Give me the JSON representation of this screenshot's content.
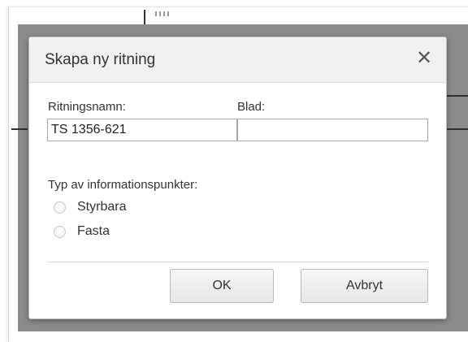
{
  "dialog": {
    "title": "Skapa ny ritning",
    "close_icon": "close-icon",
    "close_glyph": "✕"
  },
  "form": {
    "drawing_name_label": "Ritningsnamn:",
    "drawing_name_value": "TS 1356-621",
    "sheet_label": "Blad:",
    "sheet_value": "",
    "info_points_label": "Typ av informationspunkter:",
    "radio_options": [
      {
        "label": "Styrbara",
        "selected": false
      },
      {
        "label": "Fasta",
        "selected": false
      }
    ]
  },
  "buttons": {
    "ok_label": "OK",
    "cancel_label": "Avbryt"
  },
  "colors": {
    "overlay": "#8c8c8c",
    "header_bg": "#f1f1f1",
    "button_bg": "#ececec"
  }
}
